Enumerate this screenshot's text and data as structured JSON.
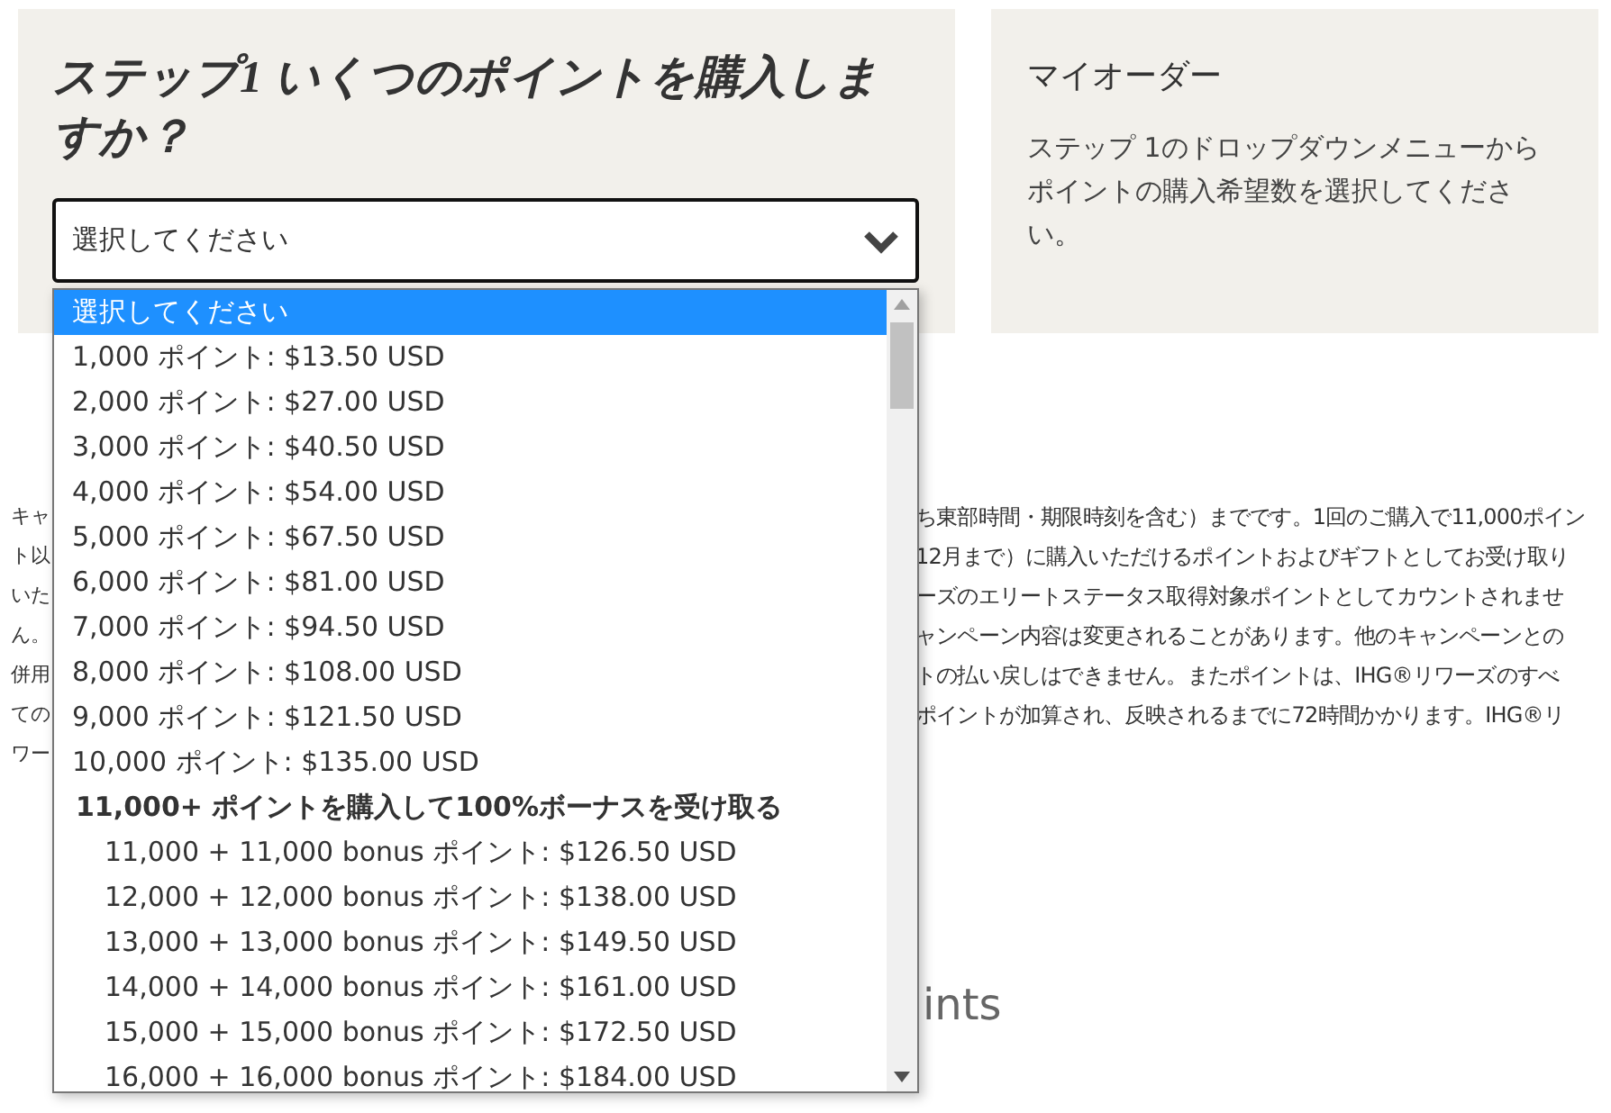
{
  "step_panel": {
    "title": "ステップ1 いくつのポイントを購入しますか？",
    "select": {
      "value": "選択してください",
      "expanded": true
    }
  },
  "dropdown": {
    "options": [
      {
        "kind": "option",
        "label": "選択してください",
        "selected": true
      },
      {
        "kind": "option",
        "label": "1,000 ポイント: $13.50 USD",
        "selected": false
      },
      {
        "kind": "option",
        "label": "2,000 ポイント: $27.00 USD",
        "selected": false
      },
      {
        "kind": "option",
        "label": "3,000 ポイント: $40.50 USD",
        "selected": false
      },
      {
        "kind": "option",
        "label": "4,000 ポイント: $54.00 USD",
        "selected": false
      },
      {
        "kind": "option",
        "label": "5,000 ポイント: $67.50 USD",
        "selected": false
      },
      {
        "kind": "option",
        "label": "6,000 ポイント: $81.00 USD",
        "selected": false
      },
      {
        "kind": "option",
        "label": "7,000 ポイント: $94.50 USD",
        "selected": false
      },
      {
        "kind": "option",
        "label": "8,000 ポイント: $108.00 USD",
        "selected": false
      },
      {
        "kind": "option",
        "label": "9,000 ポイント: $121.50 USD",
        "selected": false
      },
      {
        "kind": "option",
        "label": "10,000 ポイント: $135.00 USD",
        "selected": false
      },
      {
        "kind": "group",
        "label": "11,000+ ポイントを購入して100%ボーナスを受け取る",
        "children": [
          {
            "kind": "option",
            "label": "11,000 + 11,000 bonus ポイント: $126.50 USD",
            "selected": false
          },
          {
            "kind": "option",
            "label": "12,000 + 12,000 bonus ポイント: $138.00 USD",
            "selected": false
          },
          {
            "kind": "option",
            "label": "13,000 + 13,000 bonus ポイント: $149.50 USD",
            "selected": false
          },
          {
            "kind": "option",
            "label": "14,000 + 14,000 bonus ポイント: $161.00 USD",
            "selected": false
          },
          {
            "kind": "option",
            "label": "15,000 + 15,000 bonus ポイント: $172.50 USD",
            "selected": false
          },
          {
            "kind": "option",
            "label": "16,000 + 16,000 bonus ポイント: $184.00 USD",
            "selected": false
          }
        ]
      }
    ]
  },
  "order_panel": {
    "title": "マイオーダー",
    "text": "ステップ 1のドロップダウンメニューからポイントの購入希望数を選択してください。"
  },
  "notice": {
    "left_fragments": [
      "キャ",
      "ト以",
      "いた",
      "ん。",
      "併用",
      "ての",
      "ワー"
    ],
    "right_lines": [
      "ち東部時間・期限時刻を含む）までです。1回のご購入で11,000ポイン",
      "12月まで）に購入いただけるポイントおよびギフトとしてお受け取り",
      "ーズのエリートステータス取得対象ポイントとしてカウントされませ",
      "ャンペーン内容は変更されることがあります。他のキャンペーンとの",
      "トの払い戻しはできません。またポイントは、IHG®リワーズのすべ",
      "ポイントが加算され、反映されるまでに72時間かかります。IHG®リ"
    ]
  },
  "heading_fragment": "ints"
}
